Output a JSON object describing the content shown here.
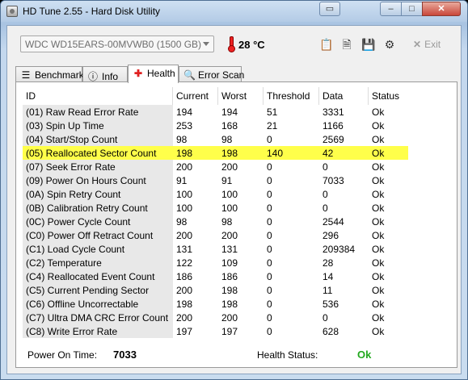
{
  "window": {
    "title": "HD Tune 2.55 - Hard Disk Utility"
  },
  "toolbar": {
    "drive": "WDC WD15EARS-00MVWB0 (1500 GB)",
    "temperature": "28 °C",
    "exit_label": "Exit",
    "icons": [
      "copy-icon",
      "copy-screenshot-icon",
      "save-icon",
      "options-icon"
    ]
  },
  "tabs": [
    {
      "label": "Benchmark",
      "icon": "benchmark-icon"
    },
    {
      "label": "Info",
      "icon": "info-icon"
    },
    {
      "label": "Health",
      "icon": "health-cross-icon",
      "active": true
    },
    {
      "label": "Error Scan",
      "icon": "magnifier-icon"
    }
  ],
  "table": {
    "headers": [
      "ID",
      "Current",
      "Worst",
      "Threshold",
      "Data",
      "Status"
    ],
    "rows": [
      {
        "id": "(01) Raw Read Error Rate",
        "current": "194",
        "worst": "194",
        "threshold": "51",
        "data": "3331",
        "status": "Ok"
      },
      {
        "id": "(03) Spin Up Time",
        "current": "253",
        "worst": "168",
        "threshold": "21",
        "data": "1166",
        "status": "Ok"
      },
      {
        "id": "(04) Start/Stop Count",
        "current": "98",
        "worst": "98",
        "threshold": "0",
        "data": "2569",
        "status": "Ok"
      },
      {
        "id": "(05) Reallocated Sector Count",
        "current": "198",
        "worst": "198",
        "threshold": "140",
        "data": "42",
        "status": "Ok",
        "highlight": true
      },
      {
        "id": "(07) Seek Error Rate",
        "current": "200",
        "worst": "200",
        "threshold": "0",
        "data": "0",
        "status": "Ok"
      },
      {
        "id": "(09) Power On Hours Count",
        "current": "91",
        "worst": "91",
        "threshold": "0",
        "data": "7033",
        "status": "Ok"
      },
      {
        "id": "(0A) Spin Retry Count",
        "current": "100",
        "worst": "100",
        "threshold": "0",
        "data": "0",
        "status": "Ok"
      },
      {
        "id": "(0B) Calibration Retry Count",
        "current": "100",
        "worst": "100",
        "threshold": "0",
        "data": "0",
        "status": "Ok"
      },
      {
        "id": "(0C) Power Cycle Count",
        "current": "98",
        "worst": "98",
        "threshold": "0",
        "data": "2544",
        "status": "Ok"
      },
      {
        "id": "(C0) Power Off Retract Count",
        "current": "200",
        "worst": "200",
        "threshold": "0",
        "data": "296",
        "status": "Ok"
      },
      {
        "id": "(C1) Load Cycle Count",
        "current": "131",
        "worst": "131",
        "threshold": "0",
        "data": "209384",
        "status": "Ok"
      },
      {
        "id": "(C2) Temperature",
        "current": "122",
        "worst": "109",
        "threshold": "0",
        "data": "28",
        "status": "Ok"
      },
      {
        "id": "(C4) Reallocated Event Count",
        "current": "186",
        "worst": "186",
        "threshold": "0",
        "data": "14",
        "status": "Ok"
      },
      {
        "id": "(C5) Current Pending Sector",
        "current": "200",
        "worst": "198",
        "threshold": "0",
        "data": "11",
        "status": "Ok"
      },
      {
        "id": "(C6) Offline Uncorrectable",
        "current": "198",
        "worst": "198",
        "threshold": "0",
        "data": "536",
        "status": "Ok"
      },
      {
        "id": "(C7) Ultra DMA CRC Error Count",
        "current": "200",
        "worst": "200",
        "threshold": "0",
        "data": "0",
        "status": "Ok"
      },
      {
        "id": "(C8) Write Error Rate",
        "current": "197",
        "worst": "197",
        "threshold": "0",
        "data": "628",
        "status": "Ok"
      }
    ]
  },
  "footer": {
    "power_on_label": "Power On Time:",
    "power_on_value": "7033",
    "health_label": "Health Status:",
    "health_value": "Ok"
  },
  "colors": {
    "highlight": "#ffff4a",
    "health_ok": "#22a81e"
  }
}
